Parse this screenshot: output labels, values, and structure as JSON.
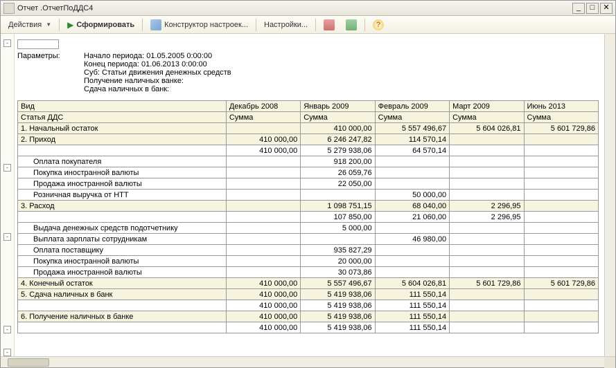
{
  "window": {
    "title": "Отчет  .ОтчетПоДДС4"
  },
  "toolbar": {
    "actions": "Действия",
    "generate": "Сформировать",
    "constructor": "Конструктор настроек...",
    "settings": "Настройки...",
    "help_glyph": "?"
  },
  "params": {
    "label": "Параметры:",
    "rows": [
      {
        "k": "Начало периода:",
        "v": "01.05.2005 0:00:00"
      },
      {
        "k": "Конец периода:",
        "v": "01.06.2013 0:00:00"
      },
      {
        "k": "Суб:",
        "v": "Статьи движения денежных средств"
      },
      {
        "k": "Получение наличных ванке:",
        "v": ""
      },
      {
        "k": "Сдача наличных в банк:",
        "v": ""
      }
    ]
  },
  "columns": {
    "name1": "Вид",
    "name2": "Статья ДДС",
    "periods": [
      "Декабрь 2008",
      "Январь 2009",
      "Февраль 2009",
      "Март 2009",
      "Июнь 2013"
    ],
    "sum": "Сумма"
  },
  "rows": [
    {
      "type": "section",
      "label": "1. Начальный остаток",
      "vals": [
        "",
        "410 000,00",
        "5 557 496,67",
        "5 604 026,81",
        "5 601 729,86"
      ]
    },
    {
      "type": "section",
      "label": "2. Приход",
      "vals": [
        "410 000,00",
        "6 246 247,82",
        "114 570,14",
        "",
        ""
      ]
    },
    {
      "type": "plain",
      "label": "",
      "vals": [
        "410 000,00",
        "5 279 938,06",
        "64 570,14",
        "",
        ""
      ]
    },
    {
      "type": "sub",
      "label": "Оплата покупателя",
      "vals": [
        "",
        "918 200,00",
        "",
        "",
        ""
      ]
    },
    {
      "type": "sub",
      "label": "Покупка иностранной валюты",
      "vals": [
        "",
        "26 059,76",
        "",
        "",
        ""
      ]
    },
    {
      "type": "sub",
      "label": "Продажа иностранной валюты",
      "vals": [
        "",
        "22 050,00",
        "",
        "",
        ""
      ]
    },
    {
      "type": "sub",
      "label": "Розничная выручка от НТТ",
      "vals": [
        "",
        "",
        "50 000,00",
        "",
        ""
      ]
    },
    {
      "type": "section",
      "label": "3. Расход",
      "vals": [
        "",
        "1 098 751,15",
        "68 040,00",
        "2 296,95",
        ""
      ]
    },
    {
      "type": "plain",
      "label": "",
      "vals": [
        "",
        "107 850,00",
        "21 060,00",
        "2 296,95",
        ""
      ]
    },
    {
      "type": "sub",
      "label": "Выдача денежных средств подотчетнику",
      "vals": [
        "",
        "5 000,00",
        "",
        "",
        ""
      ]
    },
    {
      "type": "sub",
      "label": "Выплата зарплаты сотрудникам",
      "vals": [
        "",
        "",
        "46 980,00",
        "",
        ""
      ]
    },
    {
      "type": "sub",
      "label": "Оплата поставщику",
      "vals": [
        "",
        "935 827,29",
        "",
        "",
        ""
      ]
    },
    {
      "type": "sub",
      "label": "Покупка иностранной валюты",
      "vals": [
        "",
        "20 000,00",
        "",
        "",
        ""
      ]
    },
    {
      "type": "sub",
      "label": "Продажа иностранной валюты",
      "vals": [
        "",
        "30 073,86",
        "",
        "",
        ""
      ]
    },
    {
      "type": "section",
      "label": "4. Конечный остаток",
      "vals": [
        "410 000,00",
        "5 557 496,67",
        "5 604 026,81",
        "5 601 729,86",
        "5 601 729,86"
      ]
    },
    {
      "type": "section",
      "label": "5. Сдача наличных в банк",
      "vals": [
        "410 000,00",
        "5 419 938,06",
        "111 550,14",
        "",
        ""
      ]
    },
    {
      "type": "plain",
      "label": "",
      "vals": [
        "410 000,00",
        "5 419 938,06",
        "111 550,14",
        "",
        ""
      ]
    },
    {
      "type": "section",
      "label": "6. Получение наличных в банке",
      "vals": [
        "410 000,00",
        "5 419 938,06",
        "111 550,14",
        "",
        ""
      ]
    },
    {
      "type": "plain",
      "label": "",
      "vals": [
        "410 000,00",
        "5 419 938,06",
        "111 550,14",
        "",
        ""
      ]
    }
  ],
  "toggles": {
    "top": "-",
    "s2": "-",
    "s3": "-",
    "s5": "-",
    "s6": "-"
  }
}
